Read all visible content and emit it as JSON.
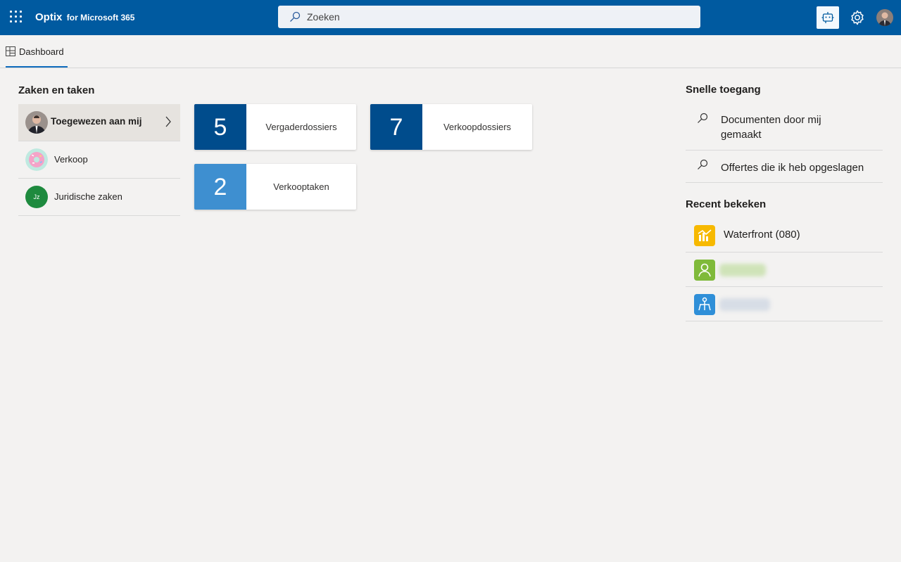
{
  "header": {
    "brand_name": "Optix",
    "brand_sub": "for Microsoft 365",
    "search_placeholder": "Zoeken",
    "accent_color": "#005aa0"
  },
  "tabs": [
    {
      "label": "Dashboard",
      "icon": "dashboard-icon",
      "active": true
    }
  ],
  "cases": {
    "title": "Zaken en taken",
    "items": [
      {
        "label": "Toegewezen aan mij",
        "icon": "user-avatar",
        "active": true
      },
      {
        "label": "Verkoop",
        "icon": "donut-avatar"
      },
      {
        "label": "Juridische zaken",
        "initials": "Jz"
      }
    ]
  },
  "tiles": [
    {
      "count": "5",
      "label": "Vergaderdossiers",
      "color": "#004c8c"
    },
    {
      "count": "7",
      "label": "Verkoopdossiers",
      "color": "#004c8c"
    },
    {
      "count": "2",
      "label": "Verkooptaken",
      "color": "#3e8fd0"
    }
  ],
  "quick_access": {
    "title": "Snelle toegang",
    "items": [
      {
        "label": "Documenten door mij gemaakt",
        "icon": "search-icon"
      },
      {
        "label": "Offertes die ik heb opgeslagen",
        "icon": "search-icon"
      }
    ]
  },
  "recent": {
    "title": "Recent bekeken",
    "items": [
      {
        "label": "Waterfront (080)",
        "icon": "chart-tile-icon",
        "color": "#f7b900"
      },
      {
        "label": "",
        "icon": "person-tile-icon",
        "color": "#7fba3a"
      },
      {
        "label": "",
        "icon": "structure-tile-icon",
        "color": "#2f8fd8"
      }
    ]
  }
}
